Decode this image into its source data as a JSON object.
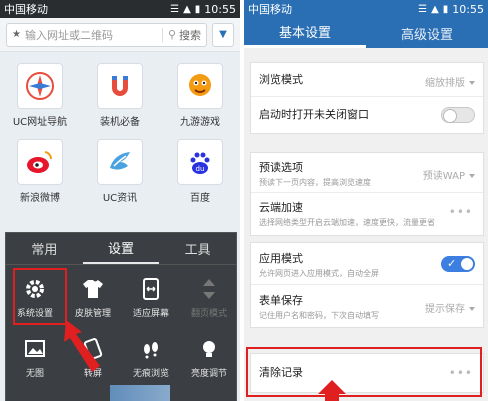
{
  "left": {
    "status": {
      "carrier": "中国移动",
      "time": "10:55"
    },
    "search": {
      "placeholder": "输入网址或二维码",
      "button": "搜索"
    },
    "apps": [
      {
        "label": "UC网址导航",
        "icon": "compass-icon"
      },
      {
        "label": "装机必备",
        "icon": "magnet-icon"
      },
      {
        "label": "九游游戏",
        "icon": "game-icon"
      },
      {
        "label": "新浪微博",
        "icon": "weibo-icon"
      },
      {
        "label": "UC资讯",
        "icon": "news-icon"
      },
      {
        "label": "百度",
        "icon": "baidu-icon"
      }
    ],
    "menu": {
      "tabs": [
        "常用",
        "设置",
        "工具"
      ],
      "active_tab": "设置",
      "items": [
        {
          "label": "系统设置",
          "icon": "gear-icon",
          "highlighted": true
        },
        {
          "label": "皮肤管理",
          "icon": "shirt-icon"
        },
        {
          "label": "适应屏幕",
          "icon": "fit-screen-icon"
        },
        {
          "label": "翻页模式",
          "icon": "page-mode-icon",
          "disabled": true
        },
        {
          "label": "无图",
          "icon": "no-image-icon"
        },
        {
          "label": "转屏",
          "icon": "rotate-icon"
        },
        {
          "label": "无痕浏览",
          "icon": "footprint-icon"
        },
        {
          "label": "亮度调节",
          "icon": "brightness-icon"
        }
      ]
    }
  },
  "right": {
    "status": {
      "carrier": "中国移动",
      "time": "10:55"
    },
    "tabs": {
      "basic": "基本设置",
      "advanced": "高级设置",
      "active": "基本设置"
    },
    "settings": {
      "browse_mode": {
        "title": "浏览模式",
        "value": "缩放排版"
      },
      "open_unclosed": {
        "title": "启动时打开未关闭窗口",
        "enabled": false
      },
      "preread": {
        "title": "预读选项",
        "desc": "预读下一页内容，提高浏览速度",
        "value": "预读WAP"
      },
      "cloud_accel": {
        "title": "云端加速",
        "desc": "选择网络类型开启云端加速，速度更快，流量更省"
      },
      "app_mode": {
        "title": "应用模式",
        "desc": "允许网页进入应用模式，自动全屏",
        "enabled": true
      },
      "form_save": {
        "title": "表单保存",
        "desc": "记住用户名和密码，下次自动填写",
        "value": "提示保存"
      },
      "clear_records": {
        "title": "清除记录",
        "highlighted": true
      }
    }
  },
  "colors": {
    "accent": "#2a6fb4",
    "highlight": "#e02020",
    "toggle_on": "#3d7fe0"
  }
}
